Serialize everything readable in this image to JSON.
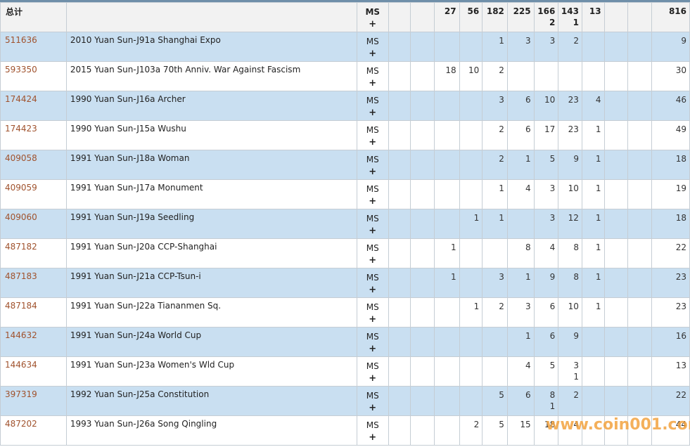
{
  "header": {
    "total_label": "总计",
    "grade": "MS",
    "plus": "+",
    "cols": [
      {
        "a": "",
        "b": ""
      },
      {
        "a": "",
        "b": ""
      },
      {
        "a": "27",
        "b": ""
      },
      {
        "a": "56",
        "b": ""
      },
      {
        "a": "182",
        "b": ""
      },
      {
        "a": "225",
        "b": ""
      },
      {
        "a": "166",
        "b": "2"
      },
      {
        "a": "143",
        "b": "1"
      },
      {
        "a": "13",
        "b": ""
      },
      {
        "a": "",
        "b": ""
      },
      {
        "a": "",
        "b": ""
      }
    ],
    "total": "816"
  },
  "rows": [
    {
      "id": "511636",
      "name": "2010 Yuan Sun-J91a Shanghai Expo",
      "grade": "MS",
      "plus": "+",
      "cells": [
        {
          "a": "",
          "b": ""
        },
        {
          "a": "",
          "b": ""
        },
        {
          "a": "",
          "b": ""
        },
        {
          "a": "",
          "b": ""
        },
        {
          "a": "1",
          "b": ""
        },
        {
          "a": "3",
          "b": ""
        },
        {
          "a": "3",
          "b": ""
        },
        {
          "a": "2",
          "b": ""
        },
        {
          "a": "",
          "b": ""
        },
        {
          "a": "",
          "b": ""
        },
        {
          "a": "",
          "b": ""
        }
      ],
      "total": "9"
    },
    {
      "id": "593350",
      "name": "2015 Yuan Sun-J103a 70th Anniv. War Against Fascism",
      "grade": "MS",
      "plus": "+",
      "cells": [
        {
          "a": "",
          "b": ""
        },
        {
          "a": "",
          "b": ""
        },
        {
          "a": "18",
          "b": ""
        },
        {
          "a": "10",
          "b": ""
        },
        {
          "a": "2",
          "b": ""
        },
        {
          "a": "",
          "b": ""
        },
        {
          "a": "",
          "b": ""
        },
        {
          "a": "",
          "b": ""
        },
        {
          "a": "",
          "b": ""
        },
        {
          "a": "",
          "b": ""
        },
        {
          "a": "",
          "b": ""
        }
      ],
      "total": "30"
    },
    {
      "id": "174424",
      "name": "1990 Yuan Sun-J16a Archer",
      "grade": "MS",
      "plus": "+",
      "cells": [
        {
          "a": "",
          "b": ""
        },
        {
          "a": "",
          "b": ""
        },
        {
          "a": "",
          "b": ""
        },
        {
          "a": "",
          "b": ""
        },
        {
          "a": "3",
          "b": ""
        },
        {
          "a": "6",
          "b": ""
        },
        {
          "a": "10",
          "b": ""
        },
        {
          "a": "23",
          "b": ""
        },
        {
          "a": "4",
          "b": ""
        },
        {
          "a": "",
          "b": ""
        },
        {
          "a": "",
          "b": ""
        }
      ],
      "total": "46"
    },
    {
      "id": "174423",
      "name": "1990 Yuan Sun-J15a Wushu",
      "grade": "MS",
      "plus": "+",
      "cells": [
        {
          "a": "",
          "b": ""
        },
        {
          "a": "",
          "b": ""
        },
        {
          "a": "",
          "b": ""
        },
        {
          "a": "",
          "b": ""
        },
        {
          "a": "2",
          "b": ""
        },
        {
          "a": "6",
          "b": ""
        },
        {
          "a": "17",
          "b": ""
        },
        {
          "a": "23",
          "b": ""
        },
        {
          "a": "1",
          "b": ""
        },
        {
          "a": "",
          "b": ""
        },
        {
          "a": "",
          "b": ""
        }
      ],
      "total": "49"
    },
    {
      "id": "409058",
      "name": "1991 Yuan Sun-J18a Woman",
      "grade": "MS",
      "plus": "+",
      "cells": [
        {
          "a": "",
          "b": ""
        },
        {
          "a": "",
          "b": ""
        },
        {
          "a": "",
          "b": ""
        },
        {
          "a": "",
          "b": ""
        },
        {
          "a": "2",
          "b": ""
        },
        {
          "a": "1",
          "b": ""
        },
        {
          "a": "5",
          "b": ""
        },
        {
          "a": "9",
          "b": ""
        },
        {
          "a": "1",
          "b": ""
        },
        {
          "a": "",
          "b": ""
        },
        {
          "a": "",
          "b": ""
        }
      ],
      "total": "18"
    },
    {
      "id": "409059",
      "name": "1991 Yuan Sun-J17a Monument",
      "grade": "MS",
      "plus": "+",
      "cells": [
        {
          "a": "",
          "b": ""
        },
        {
          "a": "",
          "b": ""
        },
        {
          "a": "",
          "b": ""
        },
        {
          "a": "",
          "b": ""
        },
        {
          "a": "1",
          "b": ""
        },
        {
          "a": "4",
          "b": ""
        },
        {
          "a": "3",
          "b": ""
        },
        {
          "a": "10",
          "b": ""
        },
        {
          "a": "1",
          "b": ""
        },
        {
          "a": "",
          "b": ""
        },
        {
          "a": "",
          "b": ""
        }
      ],
      "total": "19"
    },
    {
      "id": "409060",
      "name": "1991 Yuan Sun-J19a Seedling",
      "grade": "MS",
      "plus": "+",
      "cells": [
        {
          "a": "",
          "b": ""
        },
        {
          "a": "",
          "b": ""
        },
        {
          "a": "",
          "b": ""
        },
        {
          "a": "1",
          "b": ""
        },
        {
          "a": "1",
          "b": ""
        },
        {
          "a": "",
          "b": ""
        },
        {
          "a": "3",
          "b": ""
        },
        {
          "a": "12",
          "b": ""
        },
        {
          "a": "1",
          "b": ""
        },
        {
          "a": "",
          "b": ""
        },
        {
          "a": "",
          "b": ""
        }
      ],
      "total": "18"
    },
    {
      "id": "487182",
      "name": "1991 Yuan Sun-J20a CCP-Shanghai",
      "grade": "MS",
      "plus": "+",
      "cells": [
        {
          "a": "",
          "b": ""
        },
        {
          "a": "",
          "b": ""
        },
        {
          "a": "1",
          "b": ""
        },
        {
          "a": "",
          "b": ""
        },
        {
          "a": "",
          "b": ""
        },
        {
          "a": "8",
          "b": ""
        },
        {
          "a": "4",
          "b": ""
        },
        {
          "a": "8",
          "b": ""
        },
        {
          "a": "1",
          "b": ""
        },
        {
          "a": "",
          "b": ""
        },
        {
          "a": "",
          "b": ""
        }
      ],
      "total": "22"
    },
    {
      "id": "487183",
      "name": "1991 Yuan Sun-J21a CCP-Tsun-i",
      "grade": "MS",
      "plus": "+",
      "cells": [
        {
          "a": "",
          "b": ""
        },
        {
          "a": "",
          "b": ""
        },
        {
          "a": "1",
          "b": ""
        },
        {
          "a": "",
          "b": ""
        },
        {
          "a": "3",
          "b": ""
        },
        {
          "a": "1",
          "b": ""
        },
        {
          "a": "9",
          "b": ""
        },
        {
          "a": "8",
          "b": ""
        },
        {
          "a": "1",
          "b": ""
        },
        {
          "a": "",
          "b": ""
        },
        {
          "a": "",
          "b": ""
        }
      ],
      "total": "23"
    },
    {
      "id": "487184",
      "name": "1991 Yuan Sun-J22a Tiananmen Sq.",
      "grade": "MS",
      "plus": "+",
      "cells": [
        {
          "a": "",
          "b": ""
        },
        {
          "a": "",
          "b": ""
        },
        {
          "a": "",
          "b": ""
        },
        {
          "a": "1",
          "b": ""
        },
        {
          "a": "2",
          "b": ""
        },
        {
          "a": "3",
          "b": ""
        },
        {
          "a": "6",
          "b": ""
        },
        {
          "a": "10",
          "b": ""
        },
        {
          "a": "1",
          "b": ""
        },
        {
          "a": "",
          "b": ""
        },
        {
          "a": "",
          "b": ""
        }
      ],
      "total": "23"
    },
    {
      "id": "144632",
      "name": "1991 Yuan Sun-J24a World Cup",
      "grade": "MS",
      "plus": "+",
      "cells": [
        {
          "a": "",
          "b": ""
        },
        {
          "a": "",
          "b": ""
        },
        {
          "a": "",
          "b": ""
        },
        {
          "a": "",
          "b": ""
        },
        {
          "a": "",
          "b": ""
        },
        {
          "a": "1",
          "b": ""
        },
        {
          "a": "6",
          "b": ""
        },
        {
          "a": "9",
          "b": ""
        },
        {
          "a": "",
          "b": ""
        },
        {
          "a": "",
          "b": ""
        },
        {
          "a": "",
          "b": ""
        }
      ],
      "total": "16"
    },
    {
      "id": "144634",
      "name": "1991 Yuan Sun-J23a Women's Wld Cup",
      "grade": "MS",
      "plus": "+",
      "cells": [
        {
          "a": "",
          "b": ""
        },
        {
          "a": "",
          "b": ""
        },
        {
          "a": "",
          "b": ""
        },
        {
          "a": "",
          "b": ""
        },
        {
          "a": "",
          "b": ""
        },
        {
          "a": "4",
          "b": ""
        },
        {
          "a": "5",
          "b": ""
        },
        {
          "a": "3",
          "b": "1"
        },
        {
          "a": "",
          "b": ""
        },
        {
          "a": "",
          "b": ""
        },
        {
          "a": "",
          "b": ""
        }
      ],
      "total": "13"
    },
    {
      "id": "397319",
      "name": "1992 Yuan Sun-J25a Constitution",
      "grade": "MS",
      "plus": "+",
      "cells": [
        {
          "a": "",
          "b": ""
        },
        {
          "a": "",
          "b": ""
        },
        {
          "a": "",
          "b": ""
        },
        {
          "a": "",
          "b": ""
        },
        {
          "a": "5",
          "b": ""
        },
        {
          "a": "6",
          "b": ""
        },
        {
          "a": "8",
          "b": "1"
        },
        {
          "a": "2",
          "b": ""
        },
        {
          "a": "",
          "b": ""
        },
        {
          "a": "",
          "b": ""
        },
        {
          "a": "",
          "b": ""
        }
      ],
      "total": "22"
    },
    {
      "id": "487202",
      "name": "1993 Yuan Sun-J26a Song Qingling",
      "grade": "MS",
      "plus": "+",
      "cells": [
        {
          "a": "",
          "b": ""
        },
        {
          "a": "",
          "b": ""
        },
        {
          "a": "",
          "b": ""
        },
        {
          "a": "2",
          "b": ""
        },
        {
          "a": "5",
          "b": ""
        },
        {
          "a": "15",
          "b": ""
        },
        {
          "a": "18",
          "b": ""
        },
        {
          "a": "4",
          "b": ""
        },
        {
          "a": "",
          "b": ""
        },
        {
          "a": "",
          "b": ""
        },
        {
          "a": "",
          "b": ""
        }
      ],
      "total": "44"
    }
  ],
  "watermark": "www.coin001.com"
}
